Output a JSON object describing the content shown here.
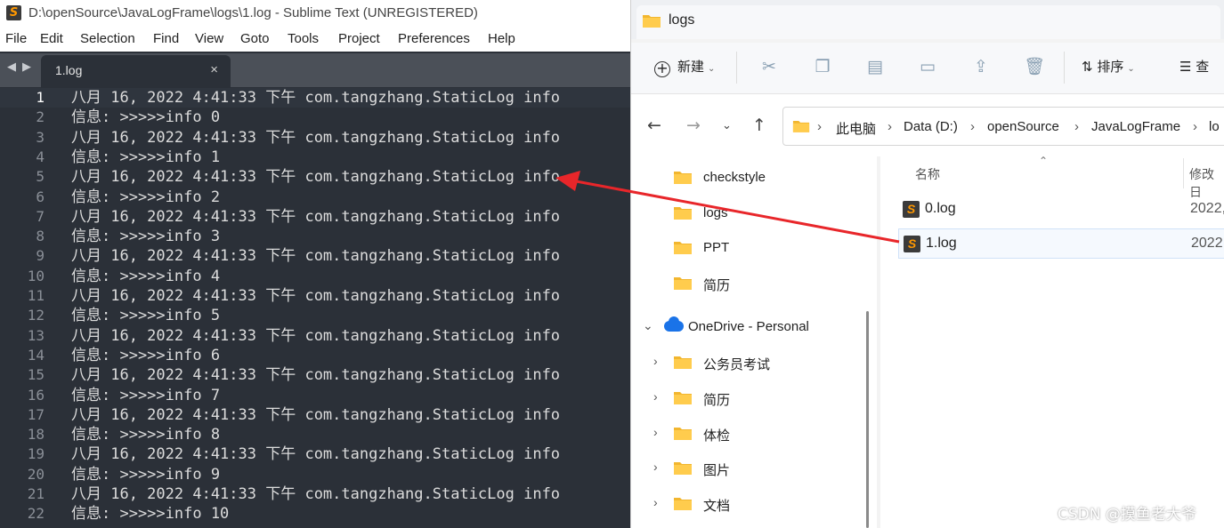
{
  "sublime": {
    "title": "D:\\openSource\\JavaLogFrame\\logs\\1.log - Sublime Text (UNREGISTERED)",
    "menu": [
      "File",
      "Edit",
      "Selection",
      "Find",
      "View",
      "Goto",
      "Tools",
      "Project",
      "Preferences",
      "Help"
    ],
    "tab": {
      "label": "1.log",
      "close": "×"
    },
    "lines": [
      {
        "n": "1",
        "text": "八月 16, 2022 4:41:33 下午 com.tangzhang.StaticLog info"
      },
      {
        "n": "2",
        "text": "信息: >>>>>info 0"
      },
      {
        "n": "3",
        "text": "八月 16, 2022 4:41:33 下午 com.tangzhang.StaticLog info"
      },
      {
        "n": "4",
        "text": "信息: >>>>>info 1"
      },
      {
        "n": "5",
        "text": "八月 16, 2022 4:41:33 下午 com.tangzhang.StaticLog info"
      },
      {
        "n": "6",
        "text": "信息: >>>>>info 2"
      },
      {
        "n": "7",
        "text": "八月 16, 2022 4:41:33 下午 com.tangzhang.StaticLog info"
      },
      {
        "n": "8",
        "text": "信息: >>>>>info 3"
      },
      {
        "n": "9",
        "text": "八月 16, 2022 4:41:33 下午 com.tangzhang.StaticLog info"
      },
      {
        "n": "10",
        "text": "信息: >>>>>info 4"
      },
      {
        "n": "11",
        "text": "八月 16, 2022 4:41:33 下午 com.tangzhang.StaticLog info"
      },
      {
        "n": "12",
        "text": "信息: >>>>>info 5"
      },
      {
        "n": "13",
        "text": "八月 16, 2022 4:41:33 下午 com.tangzhang.StaticLog info"
      },
      {
        "n": "14",
        "text": "信息: >>>>>info 6"
      },
      {
        "n": "15",
        "text": "八月 16, 2022 4:41:33 下午 com.tangzhang.StaticLog info"
      },
      {
        "n": "16",
        "text": "信息: >>>>>info 7"
      },
      {
        "n": "17",
        "text": "八月 16, 2022 4:41:33 下午 com.tangzhang.StaticLog info"
      },
      {
        "n": "18",
        "text": "信息: >>>>>info 8"
      },
      {
        "n": "19",
        "text": "八月 16, 2022 4:41:33 下午 com.tangzhang.StaticLog info"
      },
      {
        "n": "20",
        "text": "信息: >>>>>info 9"
      },
      {
        "n": "21",
        "text": "八月 16, 2022 4:41:33 下午 com.tangzhang.StaticLog info"
      },
      {
        "n": "22",
        "text": "信息: >>>>>info 10"
      }
    ]
  },
  "explorer": {
    "tab_title": "logs",
    "toolbar": {
      "new_label": "新建",
      "sort_label": "排序",
      "view_label": "查"
    },
    "address": [
      "此电脑",
      "Data (D:)",
      "openSource",
      "JavaLogFrame",
      "lo"
    ],
    "nav": {
      "folders": [
        "checkstyle",
        "logs",
        "PPT",
        "简历"
      ],
      "onedrive": "OneDrive - Personal",
      "onedrive_children": [
        "公务员考试",
        "简历",
        "体检",
        "图片",
        "文档"
      ]
    },
    "columns": {
      "name": "名称",
      "modified": "修改日"
    },
    "files": [
      {
        "name": "0.log",
        "date": "2022,"
      },
      {
        "name": "1.log",
        "date": "2022,"
      }
    ]
  },
  "watermark": "CSDN @摸鱼老大爷",
  "colors": {
    "arrow": "#e8262a",
    "editor_bg": "#2b3038",
    "sublime_accent": "#ff9800"
  }
}
